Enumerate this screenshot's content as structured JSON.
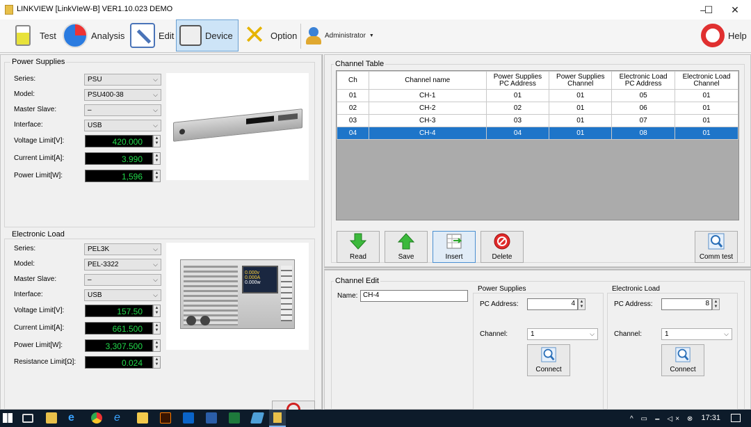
{
  "window": {
    "title": "LINKVIEW [LinkVIeW-B] VER1.10.023 DEMO",
    "minimize": "–",
    "maximize": "☐",
    "close": "✕"
  },
  "toolbar": {
    "test": "Test",
    "analysis": "Analysis",
    "edit": "Edit",
    "device": "Device",
    "option": "Option",
    "administrator": "Administrator",
    "help": "Help"
  },
  "power_supplies": {
    "legend": "Power Supplies",
    "series_label": "Series:",
    "series_value": "PSU",
    "model_label": "Model:",
    "model_value": "PSU400-38",
    "master_slave_label": "Master Slave:",
    "master_slave_value": "–",
    "interface_label": "Interface:",
    "interface_value": "USB",
    "voltage_label": "Voltage Limit[V]:",
    "voltage_value": "420.000",
    "current_label": "Current Limit[A]:",
    "current_value": "3.990",
    "power_label": "Power Limit[W]:",
    "power_value": "1,596"
  },
  "electronic_load": {
    "legend": "Electronic Load",
    "series_label": "Series:",
    "series_value": "PEL3K",
    "model_label": "Model:",
    "model_value": "PEL-3322",
    "master_slave_label": "Master Slave:",
    "master_slave_value": "–",
    "interface_label": "Interface:",
    "interface_value": "USB",
    "voltage_label": "Voltage Limit[V]:",
    "voltage_value": "157.50",
    "current_label": "Current Limit[A]:",
    "current_value": "661.500",
    "power_label": "Power Limit[W]:",
    "power_value": "3,307.500",
    "resistance_label": "Resistance Limit[Ω]:",
    "resistance_value": "0.024",
    "screen_line1": "0.000v 0.000A",
    "screen_line2": "0.000w"
  },
  "channel_table": {
    "legend": "Channel Table",
    "headers": {
      "ch": "Ch",
      "name": "Channel name",
      "ps_addr_1": "Power Supplies",
      "ps_addr_2": "PC Address",
      "ps_ch_1": "Power Supplies",
      "ps_ch_2": "Channel",
      "el_addr_1": "Electronic Load",
      "el_addr_2": "PC Address",
      "el_ch_1": "Electronic Load",
      "el_ch_2": "Channel"
    },
    "rows": [
      {
        "ch": "01",
        "name": "CH-1",
        "ps_addr": "01",
        "ps_ch": "01",
        "el_addr": "05",
        "el_ch": "01"
      },
      {
        "ch": "02",
        "name": "CH-2",
        "ps_addr": "02",
        "ps_ch": "01",
        "el_addr": "06",
        "el_ch": "01"
      },
      {
        "ch": "03",
        "name": "CH-3",
        "ps_addr": "03",
        "ps_ch": "01",
        "el_addr": "07",
        "el_ch": "01"
      },
      {
        "ch": "04",
        "name": "CH-4",
        "ps_addr": "04",
        "ps_ch": "01",
        "el_addr": "08",
        "el_ch": "01"
      }
    ],
    "selected_row": 3
  },
  "actions": {
    "read": "Read",
    "save": "Save",
    "insert": "Insert",
    "delete": "Delete",
    "comm_test": "Comm test"
  },
  "channel_edit": {
    "legend": "Channel Edit",
    "name_label": "Name:",
    "name_value": "CH-4",
    "ps_legend": "Power Supplies",
    "ps_pc_address_label": "PC Address:",
    "ps_pc_address_value": "4",
    "ps_channel_label": "Channel:",
    "ps_channel_value": "1",
    "ps_connect": "Connect",
    "el_legend": "Electronic Load",
    "el_pc_address_label": "PC Address:",
    "el_pc_address_value": "8",
    "el_channel_label": "Channel:",
    "el_channel_value": "1",
    "el_connect": "Connect"
  },
  "taskbar": {
    "time": "17:31",
    "tray": "^ ▭ 🗕 ◁× ⊗"
  }
}
